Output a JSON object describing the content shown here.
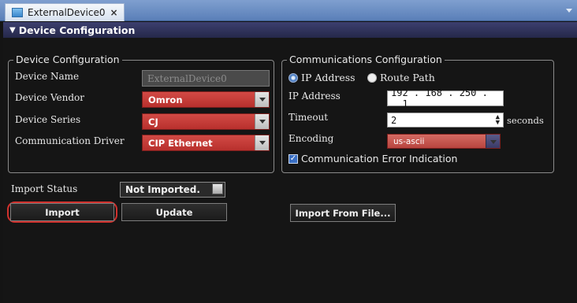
{
  "tab": {
    "title": "ExternalDevice0",
    "close": "×"
  },
  "section": {
    "title": "Device Configuration",
    "arrow": "▼"
  },
  "device_config": {
    "legend": "Device Configuration",
    "name_label": "Device Name",
    "name_value": "ExternalDevice0",
    "vendor_label": "Device Vendor",
    "vendor_value": "Omron",
    "series_label": "Device Series",
    "series_value": "CJ",
    "driver_label": "Communication Driver",
    "driver_value": "CIP Ethernet"
  },
  "comm_config": {
    "legend": "Communications Configuration",
    "radio_ip_label": "IP Address",
    "radio_route_label": "Route Path",
    "ip_label": "IP Address",
    "ip_value": "192 . 168 . 250 . __1",
    "timeout_label": "Timeout",
    "timeout_value": "2",
    "timeout_unit": "seconds",
    "encoding_label": "Encoding",
    "encoding_value": "us-ascii",
    "error_indication_label": "Communication Error Indication"
  },
  "import_status": {
    "label": "Import Status",
    "value": "Not Imported."
  },
  "buttons": {
    "import": "Import",
    "update": "Update",
    "import_from_file": "Import From File..."
  },
  "colors": {
    "accent_red": "#c0302c",
    "header": "#2e3160",
    "tab_blue": "#6f91c6"
  }
}
